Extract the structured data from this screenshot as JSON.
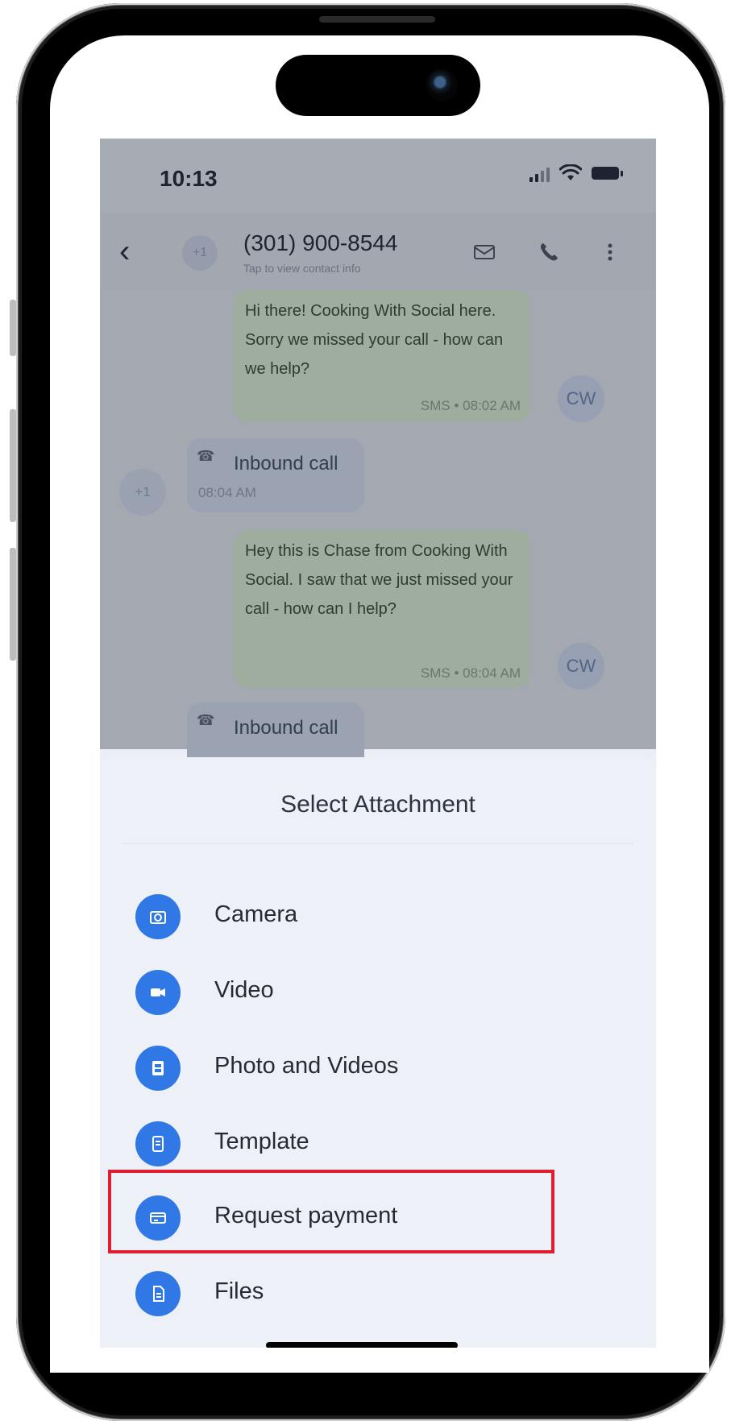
{
  "status": {
    "time": "10:13"
  },
  "header": {
    "contact_name": "(301) 900-8544",
    "contact_subtitle": "Tap to view contact info",
    "avatar_initial": "+1"
  },
  "messages": [
    {
      "type": "out",
      "text": "Hi there! Cooking With Social here. Sorry we missed your call - how can we help?",
      "meta": "SMS • 08:02 AM",
      "avatar": "CW"
    },
    {
      "type": "in",
      "text": "Inbound call",
      "meta": "08:04 AM",
      "avatar": "+1"
    },
    {
      "type": "out",
      "text": "Hey this is Chase from Cooking With Social. I saw that we just missed your call - how can I help?",
      "meta": "SMS • 08:04 AM",
      "avatar": "CW"
    },
    {
      "type": "in",
      "text": "Inbound call"
    }
  ],
  "sheet": {
    "title": "Select Attachment",
    "options": [
      {
        "label": "Camera",
        "icon": "camera-icon"
      },
      {
        "label": "Video",
        "icon": "video-icon"
      },
      {
        "label": "Photo and Videos",
        "icon": "photo-videos-icon"
      },
      {
        "label": "Template",
        "icon": "template-icon"
      },
      {
        "label": "Request payment",
        "icon": "payment-icon"
      },
      {
        "label": "Files",
        "icon": "files-icon"
      }
    ]
  },
  "colors": {
    "accent": "#2f78e6",
    "highlight": "#e21d2f",
    "sheet_background": "#eef0f8"
  }
}
